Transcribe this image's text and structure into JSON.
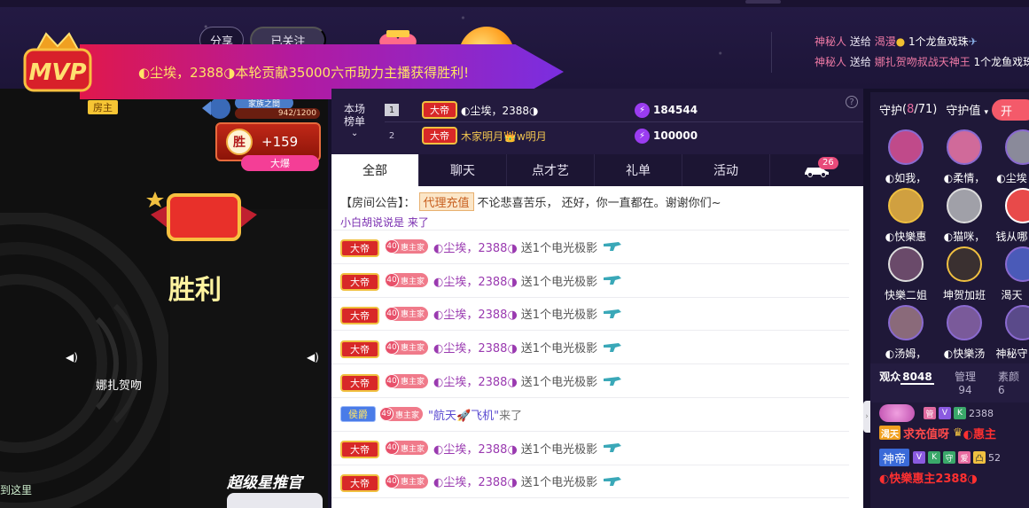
{
  "header": {
    "share_label": "分享",
    "follow_label": "已关注"
  },
  "notices": [
    {
      "who": "神秘人",
      "verb": "送给",
      "to": "渴漫",
      "txt": "1个龙鱼戏珠"
    },
    {
      "who": "神秘人",
      "verb": "送给",
      "to": "娜扎贺吻叔战天神王",
      "txt": "1个龙鱼戏珠"
    }
  ],
  "mvp": {
    "logo_text": "MVP",
    "message": "◐尘埃，2388◑本轮贡献35000六币助力主播获得胜利!"
  },
  "video": {
    "host_badge": "房主",
    "fan_badge": "家族之間",
    "fan_progress": "942/1200",
    "win_label": "胜",
    "win_score": "+159",
    "big_kill": "大爆",
    "victory_text": "胜利",
    "anchor_name": "娜扎贺吻",
    "arrived_text": "到这里",
    "super_star": "超级星推官"
  },
  "rank": {
    "label_line1": "本场",
    "label_line2": "榜单",
    "rows": [
      {
        "no": "1",
        "title": "大帝",
        "name": "◐尘埃，2388◑",
        "score": "184544"
      },
      {
        "no": "2",
        "title": "大帝",
        "name": "木家明月👑w明月",
        "score": "100000"
      }
    ],
    "help": "?"
  },
  "tabs": [
    "全部",
    "聊天",
    "点才艺",
    "礼单",
    "活动"
  ],
  "car_count": "26",
  "chat": {
    "announce_label": "【房间公告】：",
    "agent_label": "代理充值",
    "announce_text": "不论悲喜苦乐， 还好，你一直都在。谢谢你们~",
    "partial_text": "小白胡说说是 来了",
    "messages": [
      {
        "type": "gift",
        "title": "大帝",
        "level": "40",
        "club": "惠主家",
        "nick": "◐尘埃，2388◑",
        "verb": "送1个电光极影"
      },
      {
        "type": "gift",
        "title": "大帝",
        "level": "40",
        "club": "惠主家",
        "nick": "◐尘埃，2388◑",
        "verb": "送1个电光极影"
      },
      {
        "type": "gift",
        "title": "大帝",
        "level": "40",
        "club": "惠主家",
        "nick": "◐尘埃，2388◑",
        "verb": "送1个电光极影"
      },
      {
        "type": "gift",
        "title": "大帝",
        "level": "40",
        "club": "惠主家",
        "nick": "◐尘埃，2388◑",
        "verb": "送1个电光极影"
      },
      {
        "type": "gift",
        "title": "大帝",
        "level": "40",
        "club": "惠主家",
        "nick": "◐尘埃，2388◑",
        "verb": "送1个电光极影"
      },
      {
        "type": "enter",
        "title": "侯爵",
        "level": "49",
        "club": "惠主家",
        "nick": "\"航天🚀飞机\"",
        "verb": "来了"
      },
      {
        "type": "gift",
        "title": "大帝",
        "level": "40",
        "club": "惠主家",
        "nick": "◐尘埃，2388◑",
        "verb": "送1个电光极影"
      },
      {
        "type": "gift",
        "title": "大帝",
        "level": "40",
        "club": "惠主家",
        "nick": "◐尘埃，2388◑",
        "verb": "送1个电光极影"
      }
    ]
  },
  "guards": {
    "title": "守护",
    "count_open": "(",
    "count": "8",
    "count_total": "/71)",
    "value_label": "守护值",
    "open_btn": "开",
    "items": [
      {
        "name": "◐如我，",
        "color": "#c04a8a"
      },
      {
        "name": "◐柔情，",
        "color": "#d06a9a"
      },
      {
        "name": "◐尘埃",
        "color": "#8a8a9a"
      },
      {
        "name": "◐快樂惠",
        "color": "#d0a040"
      },
      {
        "name": "◐猫咪，",
        "color": "#a0a0a8"
      },
      {
        "name": "钱从哪",
        "color": "#e84a4a"
      },
      {
        "name": "快樂二姐",
        "color": "#6a4a6a"
      },
      {
        "name": "坤贺加班",
        "color": "#3a3030"
      },
      {
        "name": "渴天",
        "color": "#4a5ab8"
      },
      {
        "name": "◐汤姆，",
        "color": "#8a6a7a"
      },
      {
        "name": "◐快樂汤",
        "color": "#7a5a9a"
      },
      {
        "name": "神秘守",
        "color": "#5a4a8a"
      }
    ]
  },
  "audience": {
    "tabs": [
      {
        "label": "观众",
        "count": "8048"
      },
      {
        "label": "管理",
        "count": "94"
      },
      {
        "label": "素颜",
        "count": "6"
      }
    ],
    "rows": [
      {
        "tags": [
          "管",
          "V",
          "K"
        ],
        "num": "2388",
        "badge": "渴天",
        "text1": "求充值呀",
        "text2": "◐惠主",
        "color1": "#ff4a4a",
        "color2": "#ff3030"
      },
      {
        "badge": "神帝",
        "tags": [
          "V",
          "K",
          "守",
          "爱",
          "凸"
        ],
        "num": "52",
        "text1": "◐快樂惠主2388◑",
        "color1": "#ff3030"
      }
    ]
  },
  "colors": {
    "accent": "#9a3cf0",
    "chat_nick": "#9a3ab0",
    "notice_pink": "#f07aa6"
  }
}
